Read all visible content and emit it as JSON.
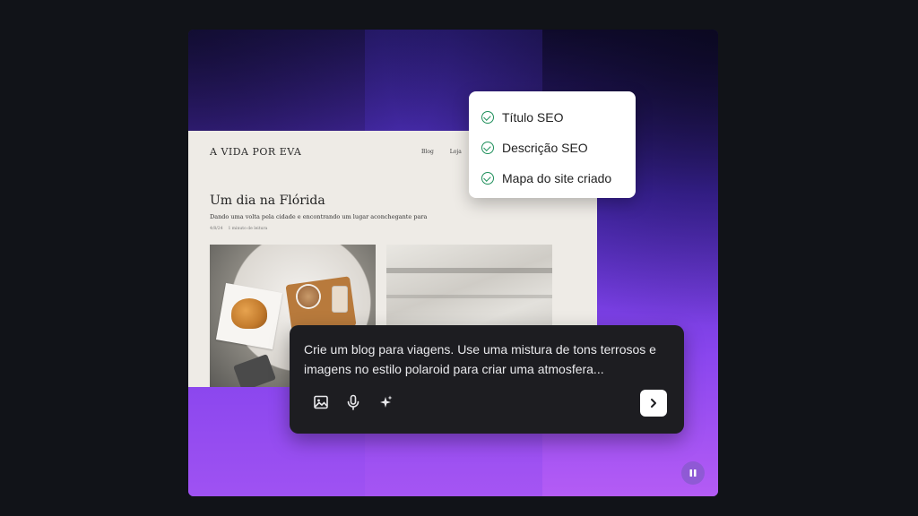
{
  "seo_checklist": {
    "items": [
      {
        "label": "Título SEO",
        "icon": "check-circle-icon"
      },
      {
        "label": "Descrição SEO",
        "icon": "check-circle-icon"
      },
      {
        "label": "Mapa do site criado",
        "icon": "check-circle-icon"
      }
    ],
    "check_color": "#1e8f5a"
  },
  "blog_preview": {
    "site_title": "A VIDA POR EVA",
    "nav": [
      "Blog",
      "Loja"
    ],
    "post_title": "Um dia na Flórida",
    "post_subtitle": "Dando uma volta pela cidade e encontrando um lugar aconchegante para",
    "post_meta": {
      "date": "4/8/24",
      "read_time": "1 minuto de leitura"
    }
  },
  "prompt_box": {
    "text": "Crie um blog para viagens. Use uma mistura de tons terrosos e imagens no estilo polaroid para criar uma atmosfera...",
    "tools": [
      "image-icon",
      "microphone-icon",
      "sparkle-icon"
    ],
    "send_icon": "chevron-right-icon"
  },
  "player": {
    "pause_icon": "pause-icon"
  },
  "colors": {
    "background": "#111318",
    "accent_purple": "#8a46ee",
    "prompt_bg": "#1d1d21"
  }
}
